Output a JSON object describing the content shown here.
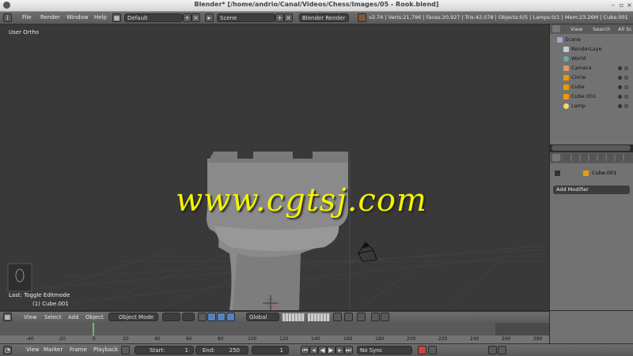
{
  "window": {
    "title": "Blender* [/home/andrio/Canal/Videos/Chess/Images/05 - Rook.blend]"
  },
  "info_header": {
    "menus": [
      "File",
      "Render",
      "Window",
      "Help"
    ],
    "screen_layout": "Default",
    "scene": "Scene",
    "render_engine": "Blender Render",
    "stats": "v2.74 | Verts:21,796 | Faces:20,927 | Tris:42,078 | Objects:0/5 | Lamps:0/1 | Mem:23.26M | Cube.001"
  },
  "viewport": {
    "view_label": "User Ortho",
    "last_op": "Last: Toggle Editmode",
    "active_object": "(1) Cube.001",
    "watermark": "www.cgtsj.com"
  },
  "viewport_header": {
    "menus": [
      "View",
      "Select",
      "Add",
      "Object"
    ],
    "mode": "Object Mode",
    "orientation": "Global"
  },
  "outliner": {
    "header": [
      "View",
      "Search",
      "All Sc"
    ],
    "items": [
      {
        "label": "Scene",
        "icon": "scene-icon"
      },
      {
        "label": "RenderLaye",
        "icon": "render-layer-icon"
      },
      {
        "label": "World",
        "icon": "world-icon"
      },
      {
        "label": "Camera",
        "icon": "camera-icon"
      },
      {
        "label": "Circle",
        "icon": "mesh-icon"
      },
      {
        "label": "Cube",
        "icon": "mesh-icon"
      },
      {
        "label": "Cube.001",
        "icon": "mesh-icon"
      },
      {
        "label": "Lamp",
        "icon": "lamp-icon"
      }
    ]
  },
  "properties": {
    "object_name": "Cube.001",
    "add_modifier": "Add Modifier"
  },
  "timeline": {
    "ticks": [
      "-40",
      "-20",
      "0",
      "20",
      "40",
      "60",
      "80",
      "100",
      "120",
      "140",
      "160",
      "180",
      "200",
      "220",
      "240",
      "260",
      "280"
    ],
    "menus": [
      "View",
      "Marker",
      "Frame",
      "Playback"
    ],
    "start_label": "Start:",
    "start_value": "1",
    "end_label": "End:",
    "end_value": "250",
    "current_frame": "1",
    "sync": "No Sync"
  },
  "colors": {
    "viewport_bg": "#393939",
    "panel_bg": "#727272",
    "header_bg": "#5a5a5a",
    "watermark": "#f3f300"
  }
}
